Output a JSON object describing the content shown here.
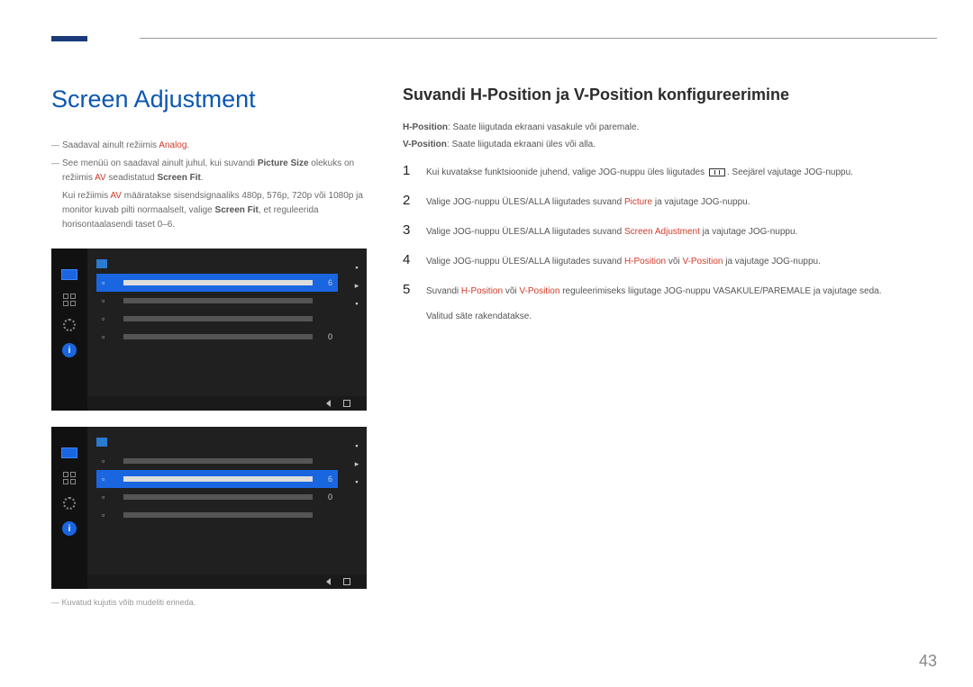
{
  "topbar": {},
  "left": {
    "heading": "Screen Adjustment",
    "note1_a": "Saadaval ainult režiimis ",
    "note1_b": "Analog",
    "note1_c": ".",
    "note2_a": "See menüü on saadaval ainult juhul, kui suvandi ",
    "note2_b": "Picture Size",
    "note2_c": " olekuks on režiimis ",
    "note2_d": "AV",
    "note2_e": " seadistatud ",
    "note2_f": "Screen Fit",
    "note2_g": ".",
    "note2_sub1a": "Kui režiimis ",
    "note2_sub1b": "AV",
    "note2_sub1c": " määratakse sisendsignaaliks 480p, 576p, 720p või 1080p ja monitor kuvab pilti normaalselt, valige ",
    "note2_sub1d": "Screen Fit",
    "note2_sub1e": ", et reguleerida horisontaalasendi taset 0–6.",
    "footnote": "― Kuvatud kujutis võib mudeliti erineda.",
    "osd1": {
      "rows": [
        {
          "val": "6",
          "active": true
        },
        {
          "val": "",
          "active": false
        },
        {
          "val": "",
          "active": false
        },
        {
          "val": "0",
          "active": false
        }
      ]
    },
    "osd2": {
      "rows": [
        {
          "val": "",
          "active": false
        },
        {
          "val": "6",
          "active": true
        },
        {
          "val": "0",
          "active": false
        },
        {
          "val": "",
          "active": false
        }
      ]
    }
  },
  "right": {
    "heading": "Suvandi H-Position ja V-Position konfigureerimine",
    "hpos_label": "H-Position",
    "hpos_desc": ": Saate liigutada ekraani vasakule või paremale.",
    "vpos_label": "V-Position",
    "vpos_desc": ": Saate liigutada ekraani üles või alla.",
    "steps": [
      {
        "n": "1",
        "parts": [
          {
            "t": "Kui kuvatakse funktsioonide juhend, valige JOG-nuppu üles liigutades "
          },
          {
            "icon": true
          },
          {
            "t": ". Seejärel vajutage JOG-nuppu."
          }
        ]
      },
      {
        "n": "2",
        "parts": [
          {
            "t": "Valige JOG-nuppu ÜLES/ALLA liigutades suvand "
          },
          {
            "red": "Picture"
          },
          {
            "t": " ja vajutage JOG-nuppu."
          }
        ]
      },
      {
        "n": "3",
        "parts": [
          {
            "t": "Valige JOG-nuppu ÜLES/ALLA liigutades suvand "
          },
          {
            "red": "Screen Adjustment"
          },
          {
            "t": " ja vajutage JOG-nuppu."
          }
        ]
      },
      {
        "n": "4",
        "parts": [
          {
            "t": "Valige JOG-nuppu ÜLES/ALLA liigutades suvand "
          },
          {
            "red": "H-Position"
          },
          {
            "t": " või "
          },
          {
            "red": "V-Position"
          },
          {
            "t": " ja vajutage JOG-nuppu."
          }
        ]
      },
      {
        "n": "5",
        "parts": [
          {
            "t": "Suvandi "
          },
          {
            "red": "H-Position"
          },
          {
            "t": " või "
          },
          {
            "red": "V-Position"
          },
          {
            "t": " reguleerimiseks liigutage JOG-nuppu VASAKULE/PAREMALE ja vajutage seda."
          }
        ]
      }
    ],
    "post": "Valitud säte rakendatakse."
  },
  "pagenum": "43"
}
